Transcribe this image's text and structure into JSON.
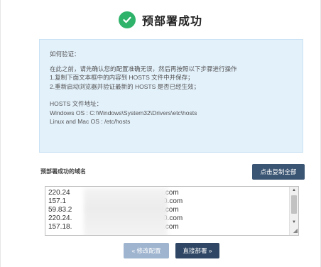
{
  "header": {
    "title": "预部署成功"
  },
  "info": {
    "how_to_verify": "如何验证：",
    "intro": "在此之前，请先确认您的配置准确无误，然后再按照以下步骤进行操作",
    "step1": "1.复制下面文本框中的内容到 HOSTS 文件中并保存；",
    "step2": "2.重新启动浏览器并验证最新的 HOSTS 是否已经生效；",
    "hosts_label": "HOSTS 文件地址：",
    "windows_path": "Windows OS : C:\\Windows\\System32\\Drivers\\etc\\hosts",
    "mac_path": "Linux and Mac OS : /etc/hosts"
  },
  "domains": {
    "label": "预部署成功的域名",
    "copy_all": "点击复制全部",
    "rows": [
      {
        "pre": "220.24",
        "post": ".com"
      },
      {
        "pre": "157.1",
        "post": "0.com"
      },
      {
        "pre": "59.83.2",
        "post": ".com"
      },
      {
        "pre": "220.24.",
        "post": "0.com"
      },
      {
        "pre": "157.18.",
        "post": ".com"
      }
    ]
  },
  "actions": {
    "modify": "« 修改配置",
    "deploy": "直接部署 »"
  },
  "colors": {
    "success": "#2fb36a",
    "info_bg": "#e3f1fb",
    "primary_button": "#3a5473",
    "disabled_button": "#9fb4cf"
  }
}
